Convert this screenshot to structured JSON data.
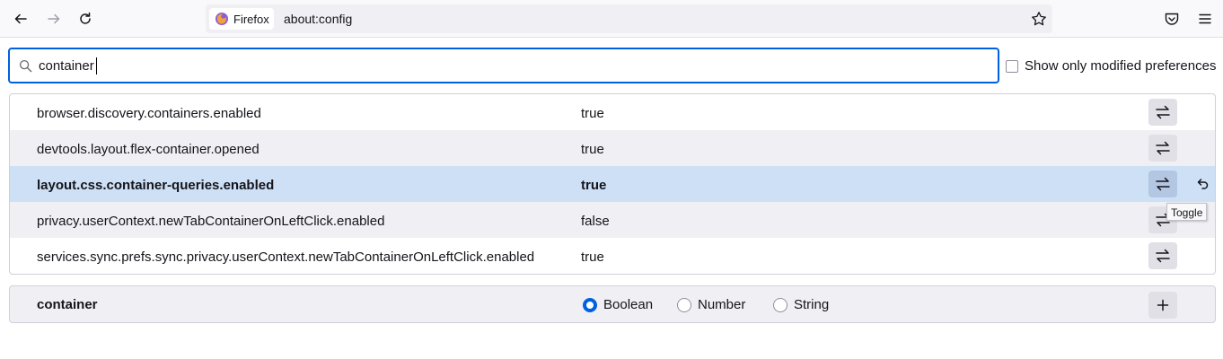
{
  "browser": {
    "identity_label": "Firefox",
    "url": "about:config",
    "icons": [
      "back-icon",
      "forward-icon",
      "reload-icon",
      "firefox-icon",
      "star-icon",
      "pocket-icon",
      "menu-icon"
    ]
  },
  "search": {
    "value": "container",
    "show_modified_label": "Show only modified preferences",
    "show_modified_checked": false
  },
  "prefs": [
    {
      "name": "browser.discovery.containers.enabled",
      "value": "true",
      "modified": false
    },
    {
      "name": "devtools.layout.flex-container.opened",
      "value": "true",
      "modified": false
    },
    {
      "name": "layout.css.container-queries.enabled",
      "value": "true",
      "modified": true
    },
    {
      "name": "privacy.userContext.newTabContainerOnLeftClick.enabled",
      "value": "false",
      "modified": false
    },
    {
      "name": "services.sync.prefs.sync.privacy.userContext.newTabContainerOnLeftClick.enabled",
      "value": "true",
      "modified": false
    }
  ],
  "tooltip": "Toggle",
  "add_row": {
    "name": "container",
    "types": [
      "Boolean",
      "Number",
      "String"
    ],
    "selected_type": "Boolean"
  },
  "colors": {
    "accent": "#0061e0",
    "selected_row": "#cde0f6",
    "alt_row": "#f0f0f4"
  }
}
